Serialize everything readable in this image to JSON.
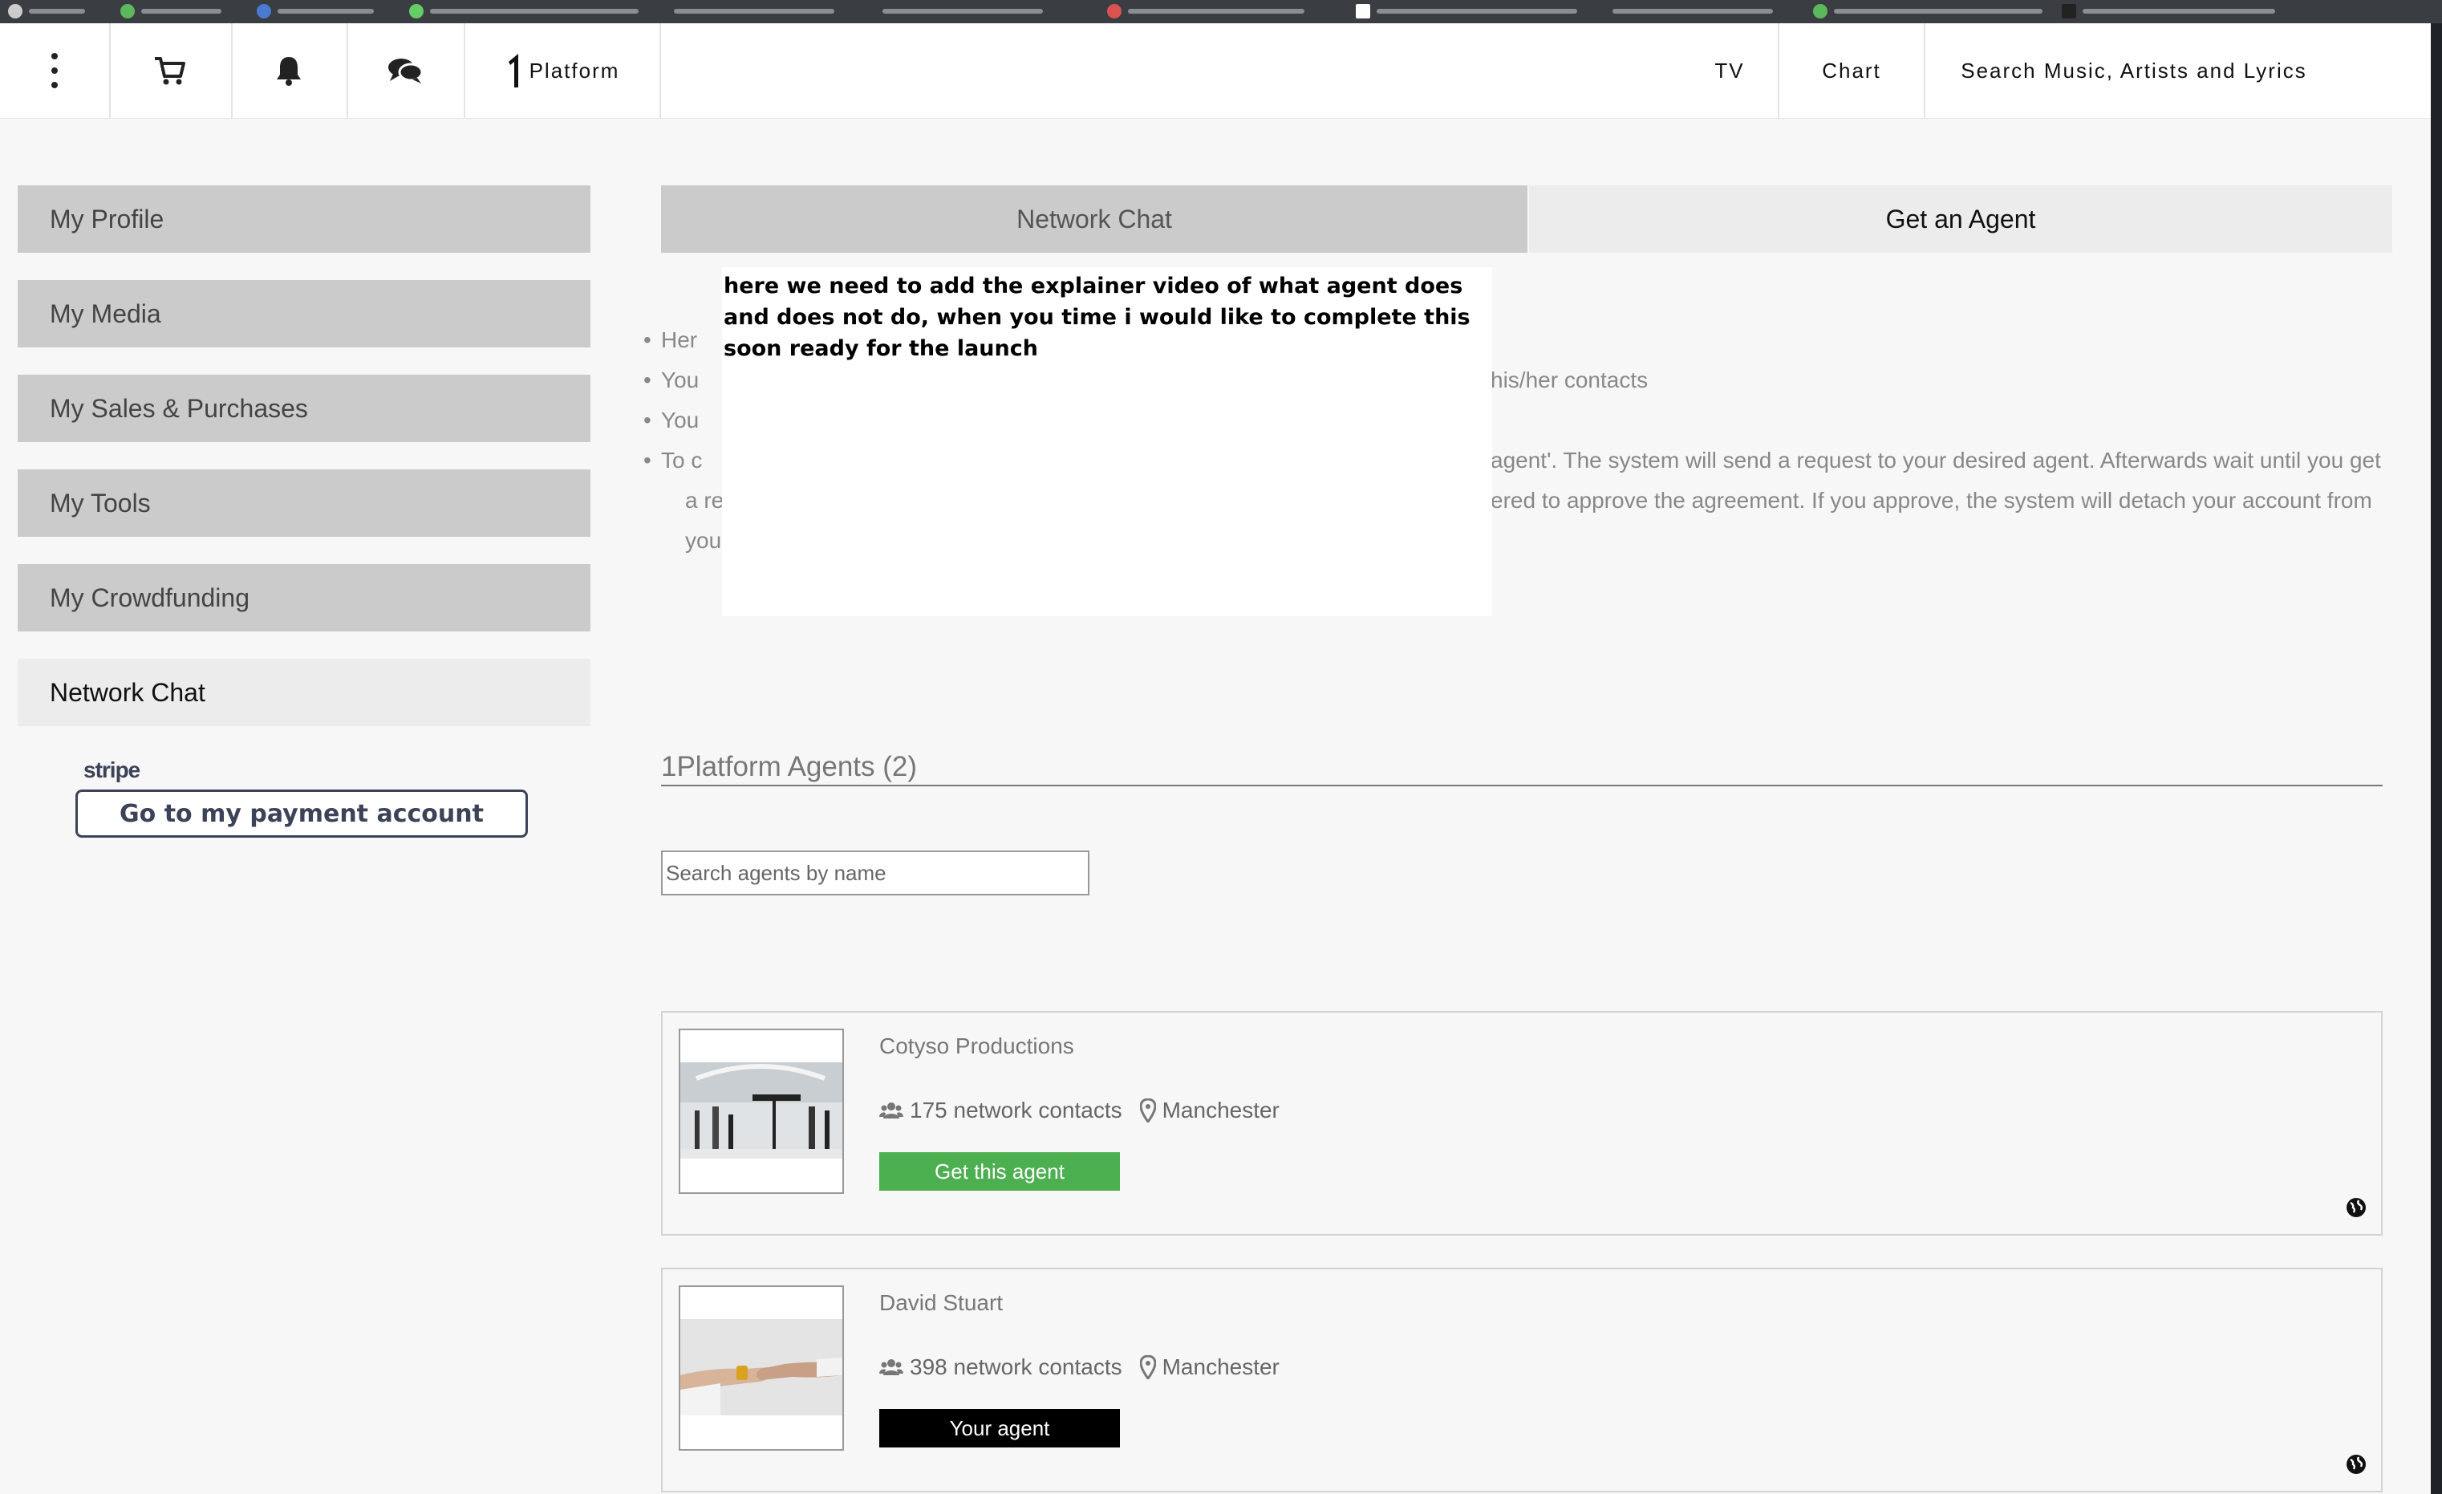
{
  "nav": {
    "menu_icon": "kebab-menu-icon",
    "cart_icon": "cart-icon",
    "bell_icon": "bell-icon",
    "chat_icon": "chat-bubbles-icon",
    "platform_label": "Platform",
    "tv_label": "TV",
    "chart_label": "Chart",
    "search_label": "Search Music, Artists and Lyrics"
  },
  "sidebar": {
    "items": [
      {
        "label": "My Profile"
      },
      {
        "label": "My Media"
      },
      {
        "label": "My Sales & Purchases"
      },
      {
        "label": "My Tools"
      },
      {
        "label": "My Crowdfunding"
      },
      {
        "label": "Network Chat"
      }
    ],
    "stripe_logo": "stripe",
    "stripe_button": "Go to my payment account"
  },
  "tabs": [
    {
      "label": "Network Chat"
    },
    {
      "label": "Get an Agent"
    }
  ],
  "info": {
    "items": [
      "Her",
      "You",
      "You",
      "To c",
      "a re",
      "you"
    ],
    "fragments": [
      "his/her contacts",
      "agent'. The system will send a request to your desired agent. Afterwards wait until you get",
      "ered to approve the agreement. If you approve, the system will detach your account from"
    ]
  },
  "note": {
    "text": "here we need to add the explainer video of what agent does and does not do, when you time i would like to complete this  soon ready for the launch"
  },
  "agents": {
    "title": "1Platform Agents (2)",
    "search_placeholder": "Search agents by name",
    "list": [
      {
        "name": "Cotyso Productions",
        "contacts": "175 network contacts",
        "location": "Manchester",
        "button": "Get this agent",
        "button_color": "#4caf50"
      },
      {
        "name": "David Stuart",
        "contacts": "398 network contacts",
        "location": "Manchester",
        "button": "Your agent",
        "button_color": "#000000"
      }
    ]
  }
}
